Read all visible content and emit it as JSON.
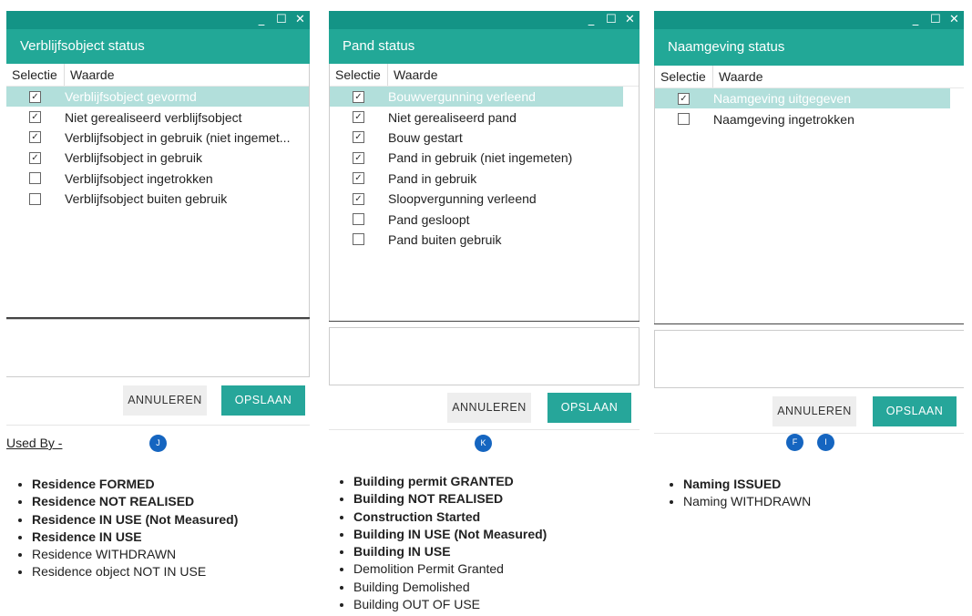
{
  "window_controls": [
    "_",
    "☐",
    "✕"
  ],
  "dialogs": [
    {
      "title": "Verblijfsobject status",
      "col_selectie": "Selectie",
      "col_waarde": "Waarde",
      "items": [
        {
          "label": "Verblijfsobject gevormd",
          "checked": true,
          "selected": true
        },
        {
          "label": "Niet gerealiseerd verblijfsobject",
          "checked": true,
          "selected": false
        },
        {
          "label": "Verblijfsobject in gebruik (niet ingemet...",
          "checked": true,
          "selected": false
        },
        {
          "label": "Verblijfsobject in gebruik",
          "checked": true,
          "selected": false
        },
        {
          "label": "Verblijfsobject ingetrokken",
          "checked": false,
          "selected": false
        },
        {
          "label": "Verblijfsobject buiten gebruik",
          "checked": false,
          "selected": false
        }
      ],
      "cancel_label": "ANNULEREN",
      "save_label": "OPSLAAN"
    },
    {
      "title": "Pand status",
      "col_selectie": "Selectie",
      "col_waarde": "Waarde",
      "items": [
        {
          "label": "Bouwvergunning verleend",
          "checked": true,
          "selected": true
        },
        {
          "label": "Niet gerealiseerd pand",
          "checked": true,
          "selected": false
        },
        {
          "label": "Bouw gestart",
          "checked": true,
          "selected": false
        },
        {
          "label": "Pand in gebruik (niet ingemeten)",
          "checked": true,
          "selected": false
        },
        {
          "label": "Pand in gebruik",
          "checked": true,
          "selected": false
        },
        {
          "label": "Sloopvergunning verleend",
          "checked": true,
          "selected": false
        },
        {
          "label": "Pand gesloopt",
          "checked": false,
          "selected": false
        },
        {
          "label": "Pand buiten gebruik",
          "checked": false,
          "selected": false
        }
      ],
      "cancel_label": "ANNULEREN",
      "save_label": "OPSLAAN"
    },
    {
      "title": "Naamgeving status",
      "col_selectie": "Selectie",
      "col_waarde": "Waarde",
      "items": [
        {
          "label": "Naamgeving uitgegeven",
          "checked": true,
          "selected": true
        },
        {
          "label": "Naamgeving ingetrokken",
          "checked": false,
          "selected": false
        }
      ],
      "cancel_label": "ANNULEREN",
      "save_label": "OPSLAAN"
    }
  ],
  "used_by_label": "Used By -",
  "badges": [
    "J",
    "K",
    "F",
    "I"
  ],
  "legends": [
    [
      {
        "text": "Residence FORMED",
        "bold": true
      },
      {
        "text": "Residence NOT REALISED",
        "bold": true
      },
      {
        "text": "Residence IN USE (Not Measured)",
        "bold": true
      },
      {
        "text": "Residence IN USE",
        "bold": true
      },
      {
        "text": "Residence WITHDRAWN",
        "bold": false
      },
      {
        "text": "Residence object NOT IN USE",
        "bold": false
      }
    ],
    [
      {
        "text": "Building permit GRANTED",
        "bold": true
      },
      {
        "text": "Building NOT REALISED",
        "bold": true
      },
      {
        "text": "Construction Started",
        "bold": true
      },
      {
        "text": "Building IN USE (Not Measured)",
        "bold": true
      },
      {
        "text": "Building IN USE",
        "bold": true
      },
      {
        "text": "Demolition Permit Granted",
        "bold": false
      },
      {
        "text": "Building Demolished",
        "bold": false
      },
      {
        "text": "Building OUT OF USE",
        "bold": false
      }
    ],
    [
      {
        "text": "Naming ISSUED",
        "bold": true
      },
      {
        "text": "Naming WITHDRAWN",
        "bold": false
      }
    ]
  ],
  "colors": {
    "titlebar": "#139486",
    "header": "#22a897",
    "selected_row": "#b2dfdb",
    "save_button": "#26a69a",
    "badge": "#1565c0"
  }
}
